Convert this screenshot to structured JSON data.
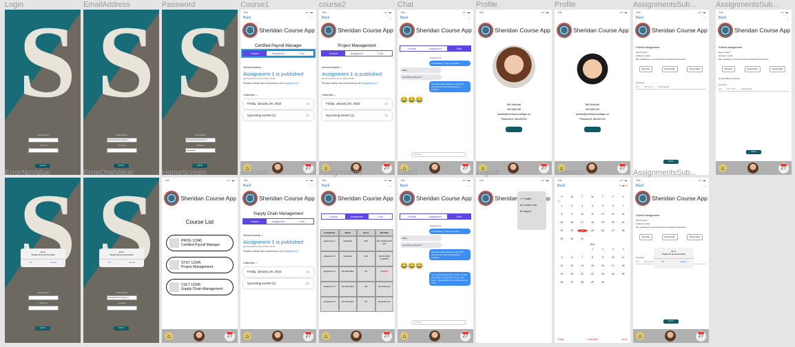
{
  "frames": [
    {
      "name": "Login"
    },
    {
      "name": "EmailAddress"
    },
    {
      "name": "Password"
    },
    {
      "name": "Course1"
    },
    {
      "name": "course2"
    },
    {
      "name": "Chat"
    },
    {
      "name": "Profile"
    },
    {
      "name": "Profile"
    },
    {
      "name": "AssignmentsSub..."
    },
    {
      "name": "AssignmentsSub..."
    },
    {
      "name": "ErrorNoValue"
    },
    {
      "name": "ErrorOneValue"
    },
    {
      "name": "HomeScreen"
    },
    {
      "name": "course3"
    },
    {
      "name": "Assignments"
    },
    {
      "name": "Chat2"
    },
    {
      "name": "Logout"
    },
    {
      "name": "Calendar"
    },
    {
      "name": "AssignmentsSub..."
    }
  ],
  "app": {
    "title": "Sheridan Course App",
    "back": "Back",
    "more": "...",
    "time": "9:41",
    "signal": "▪▪▪ ◠ ▬"
  },
  "login": {
    "email_label": "Email address",
    "password_label": "Password",
    "email_value": "kabre@sheridancollege.ca",
    "password_value": "●●●●●●●●",
    "button": "LOG IN"
  },
  "error": {
    "title": "Error",
    "message": "Please fill up all the fields",
    "ok": "OK",
    "cancel": "Cancel"
  },
  "tabs": [
    "Content",
    "Assignment",
    "Chat"
  ],
  "courses": {
    "c1": "Certified Payroll Manager",
    "c2": "Project Management",
    "c3": "Supply Chain Management"
  },
  "content": {
    "announcements": "Announcements ⌄",
    "assignment": "Assignment 1 is published",
    "author": "jhan kari",
    "posted": "posted on Jan 24, 2022 7:30 AM",
    "follow": "Please follow the instructions of",
    "link": "Assignment 1",
    "calendar": "Calendar ⌄",
    "event1": "Friday, January 28, 2022",
    "event2": "Upcoming events (1)",
    "arrow": "▷"
  },
  "chat": {
    "date": "Tuesday 10:21",
    "m1": "Hi Professor, I have a question",
    "m2": "Wow.",
    "m3": "So what is going on?",
    "m4": "We had a fresh section to have this morning who was distinguished, contacts",
    "m5": "I'm a good programmer. I mean, it's the only thing I am good at. I mean, last year, I made a iPhone and it showed my tooth.",
    "emoji": "😂😂😂",
    "placeholder": "iMessage"
  },
  "profile": {
    "name": "Ms Nobody",
    "id": "991456789",
    "email": "kabre@sheridancollege.ca",
    "password": "Password: abcd1234"
  },
  "submit": {
    "title": "Submit Assignment",
    "files": "Files to submit *",
    "files_note": "(0) file(s) to submit",
    "note": "After uploading you must click Submit to complete the submission",
    "b1": "Add a File",
    "b2": "Record Audio",
    "b3": "Record Video",
    "success": "(1) Files added successfully",
    "comments": "Comments",
    "toolbar": "¶ ≡ ← → B I U ≡ ≡ ← → Last Saved",
    "button": "Submit"
  },
  "home": {
    "title": "Course List",
    "c1code": "PROG 12345",
    "c1": "Certified Payroll Manager",
    "c2code": "SYST 12345",
    "c2": "Project Management",
    "c3code": "CULT 12345",
    "c3": "Supply Chain Management"
  },
  "assignments": {
    "headers": [
      "Assignment",
      "Status",
      "Score",
      "Due Date"
    ],
    "rows": [
      [
        "Assignment 1",
        "Submitted",
        "0/10",
        "Feb 7,2022 11:69 PM"
      ],
      [
        "Assignment 2",
        "Submitted",
        "0/10",
        "Feb 21,2022 11:69 PM"
      ],
      [
        "Assignment 3",
        "Not Submitted",
        "/10",
        "SUBMIT"
      ],
      [
        "Assignment 4",
        "Not Submitted",
        "/10",
        "Not posted yet"
      ],
      [
        "Assignment 5",
        "Not Submitted",
        "/10",
        "Not posted yet"
      ]
    ]
  },
  "logout": {
    "items": [
      "Profile",
      "Course List",
      "Logout"
    ]
  },
  "calendar": {
    "days": [
      "S",
      "M",
      "T",
      "W",
      "T",
      "F",
      "S"
    ],
    "oct": "Oct",
    "nov": "Nov",
    "footer": [
      "Today",
      "Calendars",
      "Inbox"
    ]
  },
  "dock": {
    "cal": "27"
  }
}
